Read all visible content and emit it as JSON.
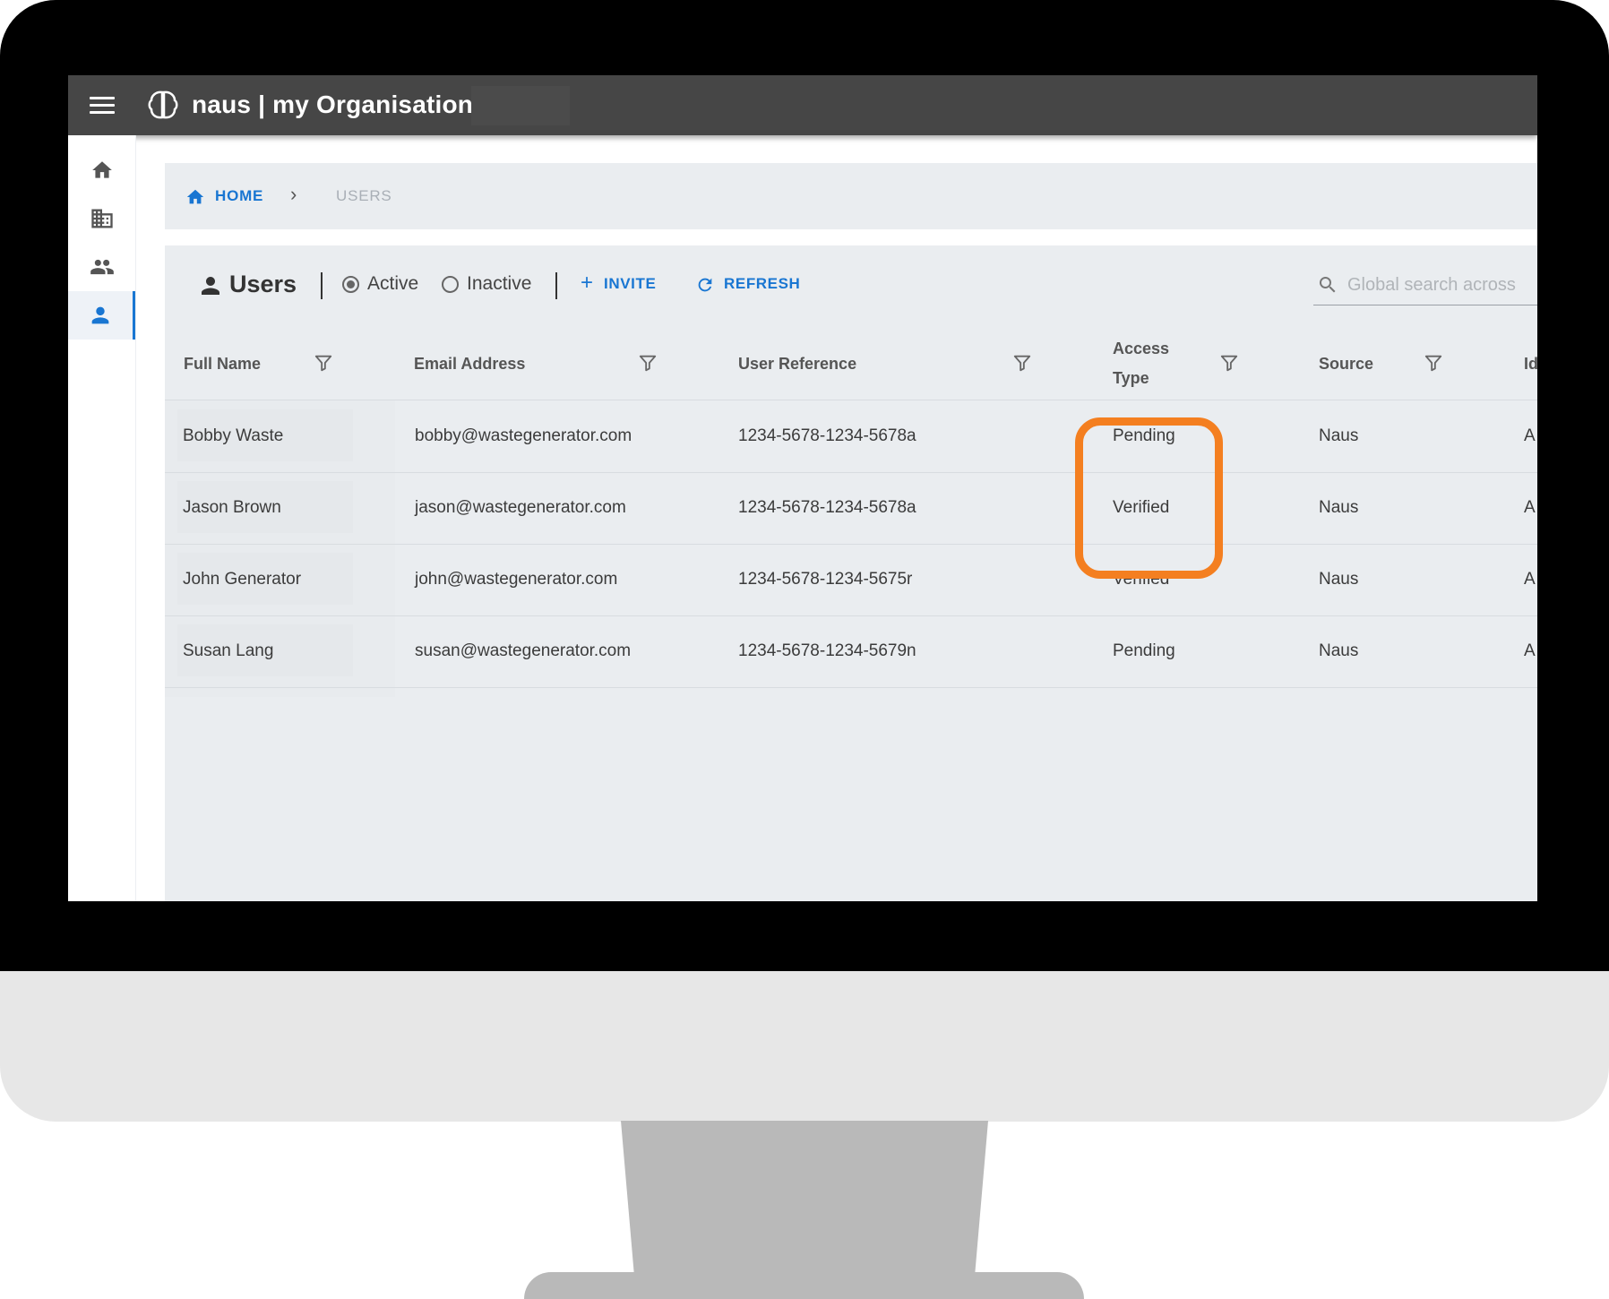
{
  "app": {
    "title": "naus | my Organisation"
  },
  "breadcrumb": {
    "home": "HOME",
    "current": "USERS"
  },
  "toolbar": {
    "title": "Users",
    "active_label": "Active",
    "inactive_label": "Inactive",
    "invite_label": "INVITE",
    "refresh_label": "REFRESH",
    "search_placeholder": "Global search across"
  },
  "table": {
    "columns": [
      {
        "label_line1": "Full Name",
        "label_line2": ""
      },
      {
        "label_line1": "Email Address",
        "label_line2": ""
      },
      {
        "label_line1": "User Reference",
        "label_line2": ""
      },
      {
        "label_line1": "Access",
        "label_line2": "Type"
      },
      {
        "label_line1": "Source",
        "label_line2": ""
      },
      {
        "label_line1": "Id",
        "label_line2": ""
      }
    ],
    "rows": [
      {
        "name": "Bobby Waste",
        "email": "bobby@wastegenerator.com",
        "ref": "1234-5678-1234-5678a",
        "access": "Pending",
        "source": "Naus",
        "extra": "A"
      },
      {
        "name": "Jason Brown",
        "email": "jason@wastegenerator.com",
        "ref": "1234-5678-1234-5678a",
        "access": "Verified",
        "source": "Naus",
        "extra": "A"
      },
      {
        "name": "John Generator",
        "email": "john@wastegenerator.com",
        "ref": "1234-5678-1234-5675r",
        "access": "Verified",
        "source": "Naus",
        "extra": "A"
      },
      {
        "name": "Susan Lang",
        "email": "susan@wastegenerator.com",
        "ref": "1234-5678-1234-5679n",
        "access": "Pending",
        "source": "Naus",
        "extra": "A"
      }
    ]
  },
  "colors": {
    "accent": "#1976d2",
    "highlight": "#f47f20",
    "topbar": "#464646"
  }
}
